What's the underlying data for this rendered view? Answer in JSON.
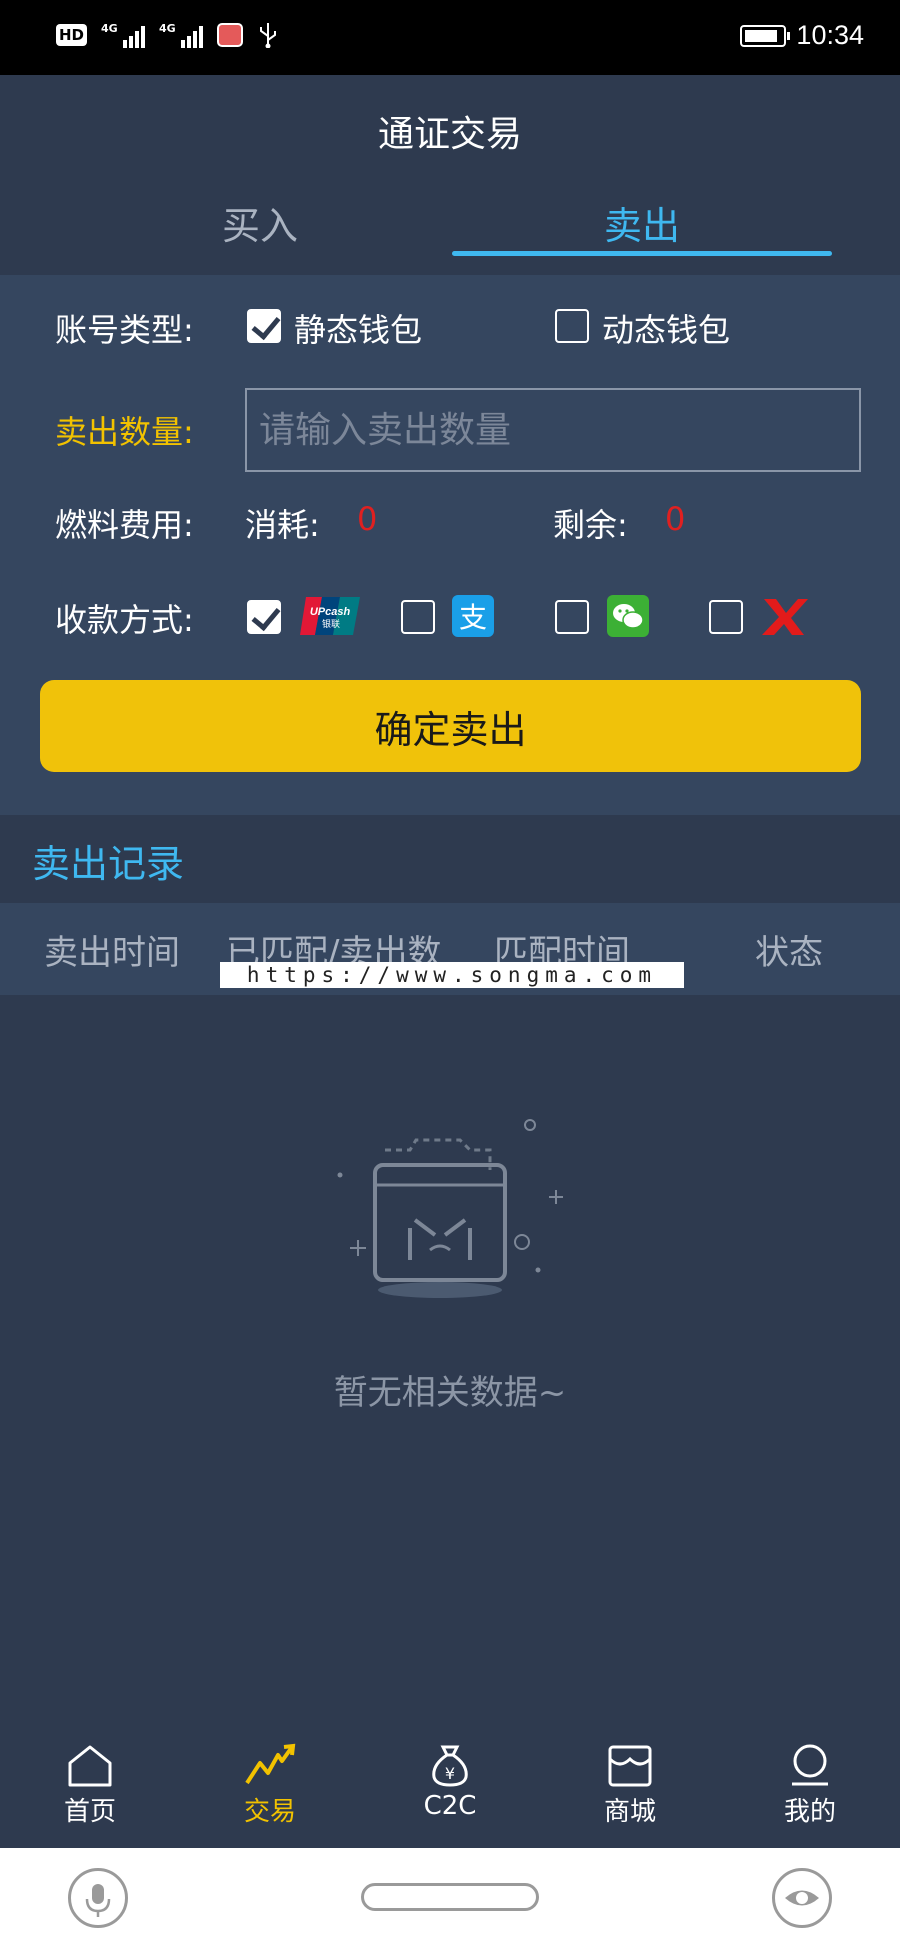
{
  "status_bar": {
    "hd": "HD",
    "network1": "4G",
    "network2": "4G",
    "time": "10:34"
  },
  "header": {
    "title": "通证交易",
    "tabs": [
      {
        "label": "买入"
      },
      {
        "label": "卖出"
      }
    ],
    "active_tab": "卖出"
  },
  "form": {
    "account_type_label": "账号类型:",
    "account_options": [
      {
        "label": "静态钱包",
        "checked": true
      },
      {
        "label": "动态钱包",
        "checked": false
      }
    ],
    "quantity_label": "卖出数量:",
    "quantity_placeholder": "请输入卖出数量",
    "fee_label": "燃料费用:",
    "consume_label": "消耗:",
    "consume_value": "0",
    "remain_label": "剩余:",
    "remain_value": "0",
    "payment_label": "收款方式:",
    "payment_methods": [
      {
        "icon": "unionpay-icon",
        "checked": true
      },
      {
        "icon": "alipay-icon",
        "checked": false
      },
      {
        "icon": "wechat-pay-icon",
        "checked": false
      },
      {
        "icon": "red-x-logo-icon",
        "checked": false
      }
    ],
    "confirm_label": "确定卖出"
  },
  "records": {
    "title": "卖出记录",
    "columns": [
      "卖出时间",
      "已匹配/卖出数",
      "匹配时间",
      "状态"
    ],
    "watermark": "https://www.songma.com",
    "empty_text": "暂无相关数据~"
  },
  "bottom_nav": {
    "items": [
      {
        "label": "首页",
        "icon": "home-icon"
      },
      {
        "label": "交易",
        "icon": "trade-chart-icon"
      },
      {
        "label": "C2C",
        "icon": "money-bag-icon"
      },
      {
        "label": "商城",
        "icon": "store-icon"
      },
      {
        "label": "我的",
        "icon": "profile-icon"
      }
    ],
    "active": "交易"
  },
  "colors": {
    "background": "#2e3a4f",
    "panel": "#35465f",
    "accent_blue": "#3fb8f0",
    "accent_yellow": "#f2c200",
    "button_yellow": "#f0c20a",
    "value_red": "#e02020"
  }
}
